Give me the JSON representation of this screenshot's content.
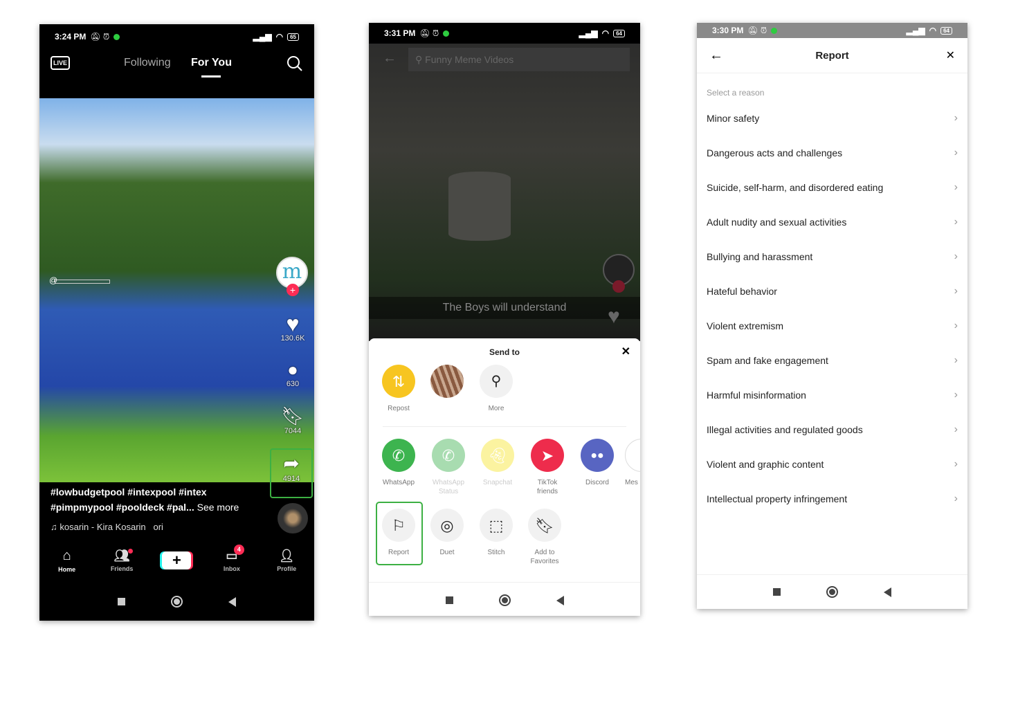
{
  "phone1": {
    "status": {
      "time": "3:24 PM",
      "battery": "65"
    },
    "header": {
      "live_label": "LIVE",
      "tabs": [
        {
          "label": "Following",
          "active": false
        },
        {
          "label": "For You",
          "active": true
        }
      ]
    },
    "rail": {
      "likes": "130.6K",
      "comments": "630",
      "bookmarks": "7044",
      "shares": "4914"
    },
    "handle_prefix": "@",
    "caption_line1": "#lowbudgetpool #intexpool #intex",
    "caption_line2": "#pimpmypool #pooldeck #pal...",
    "see_more": "See more",
    "sound": "kosarin - Kira Kosarin",
    "sound_suffix": "ori",
    "nav": {
      "home": "Home",
      "friends": "Friends",
      "inbox": "Inbox",
      "inbox_badge": "4",
      "profile": "Profile"
    }
  },
  "phone2": {
    "status": {
      "time": "3:31 PM",
      "battery": "64"
    },
    "search_placeholder": "Funny Meme Videos",
    "video_caption": "The Boys will understand",
    "sheet": {
      "title": "Send to",
      "top_row": [
        {
          "label": "Repost",
          "icon": "repost-icon"
        },
        {
          "label": "",
          "icon": "contact-avatar"
        },
        {
          "label": "More",
          "icon": "search-icon"
        }
      ],
      "share_row": [
        {
          "label": "WhatsApp",
          "color": "#3db44f"
        },
        {
          "label": "WhatsApp Status",
          "color": "#a8dcb0"
        },
        {
          "label": "Snapchat",
          "color": "#fbf3a0"
        },
        {
          "label": "TikTok friends",
          "color": "#ee2c4c"
        },
        {
          "label": "Discord",
          "color": "#5865c2"
        },
        {
          "label": "Mes",
          "color": "#ffffff"
        }
      ],
      "action_row": [
        {
          "label": "Report",
          "icon": "flag-icon"
        },
        {
          "label": "Duet",
          "icon": "duet-icon"
        },
        {
          "label": "Stitch",
          "icon": "stitch-icon"
        },
        {
          "label": "Add to Favorites",
          "icon": "bookmark-icon"
        }
      ]
    }
  },
  "phone3": {
    "status": {
      "time": "3:30 PM",
      "battery": "64"
    },
    "title": "Report",
    "section_label": "Select a reason",
    "reasons": [
      "Minor safety",
      "Dangerous acts and challenges",
      "Suicide, self-harm, and disordered eating",
      "Adult nudity and sexual activities",
      "Bullying and harassment",
      "Hateful behavior",
      "Violent extremism",
      "Spam and fake engagement",
      "Harmful misinformation",
      "Illegal activities and regulated goods",
      "Violent and graphic content",
      "Intellectual property infringement"
    ]
  },
  "colors": {
    "highlight": "#3cb043",
    "tiktok_red": "#fe2c55",
    "repost_yellow": "#f7c520"
  }
}
